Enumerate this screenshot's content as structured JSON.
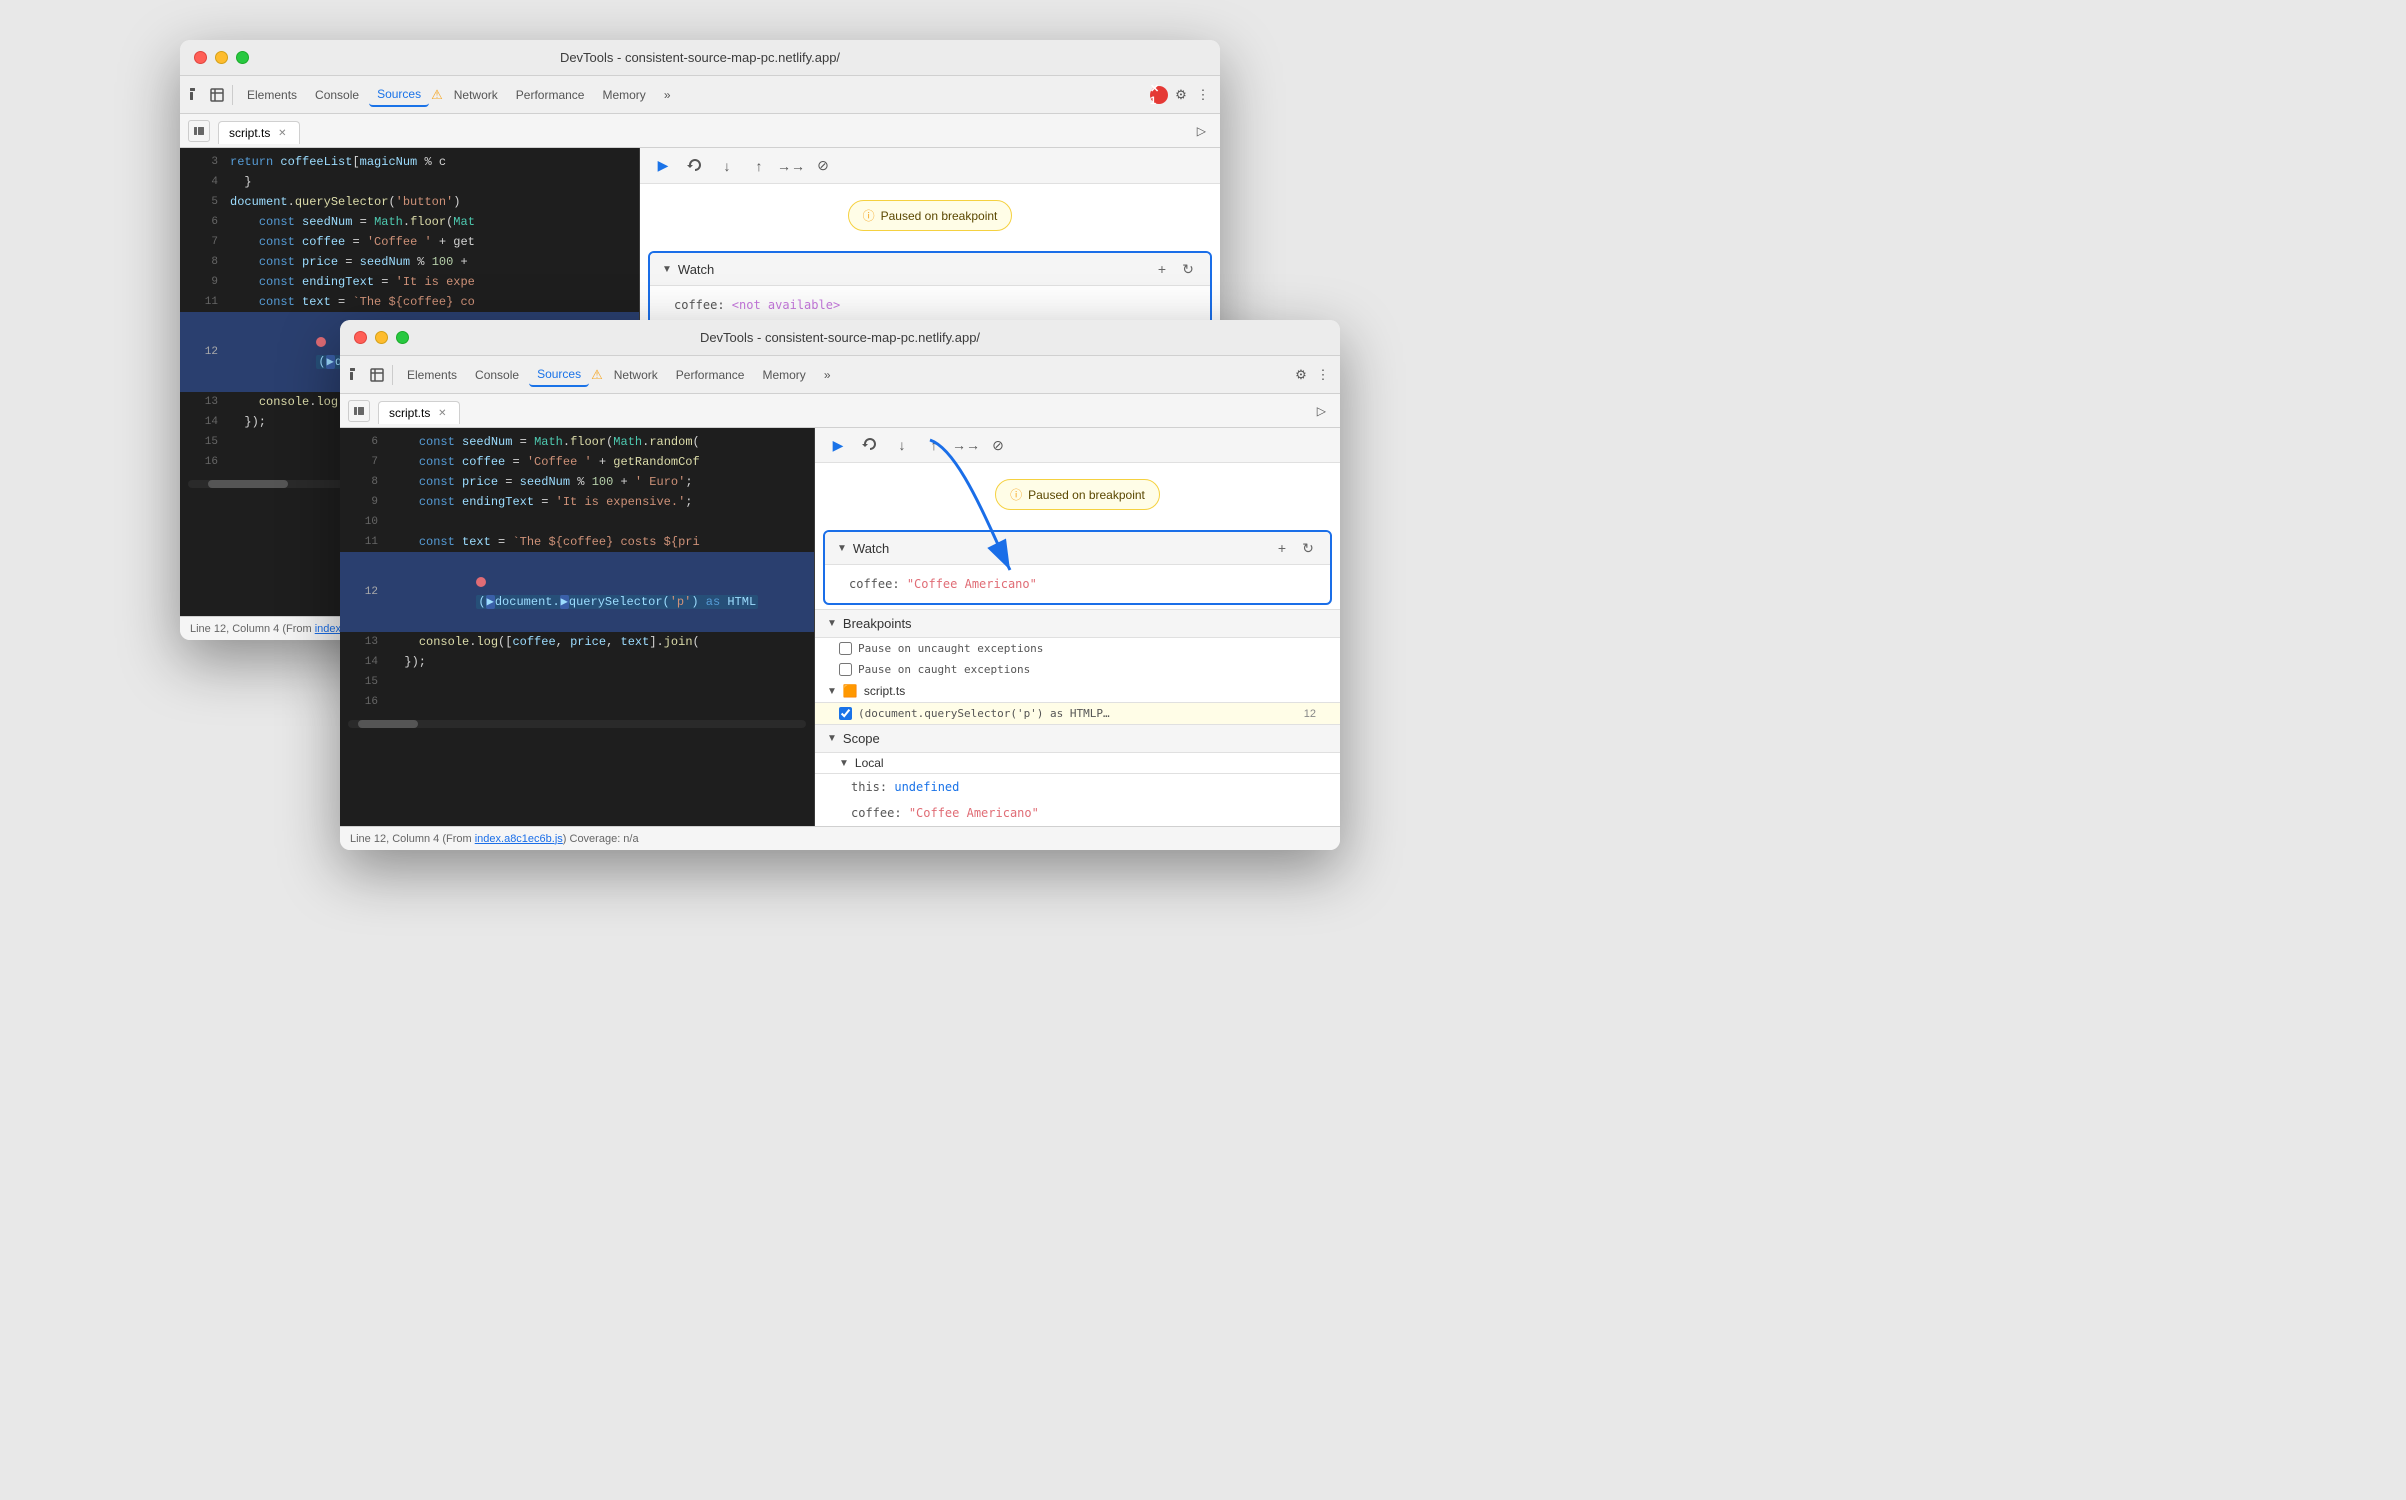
{
  "window_back": {
    "title": "DevTools - consistent-source-map-pc.netlify.app/",
    "tabs": [
      "Elements",
      "Console",
      "Sources",
      "Network",
      "Performance",
      "Memory"
    ],
    "active_tab": "Sources",
    "file_tab": "script.ts",
    "code_lines": [
      {
        "num": 3,
        "content": "    return coffeeList[magicNum % c"
      },
      {
        "num": 4,
        "content": "  }"
      },
      {
        "num": 5,
        "content": "  document.querySelector('button')"
      },
      {
        "num": 6,
        "content": "    const seedNum = Math.floor(Mat"
      },
      {
        "num": 7,
        "content": "    const coffee = 'Coffee ' + get"
      },
      {
        "num": 8,
        "content": "    const price = seedNum % 100 +"
      },
      {
        "num": 9,
        "content": "    const endingText = 'It is expe"
      },
      {
        "num": 11,
        "content": "    const text = `The ${coffee} co"
      },
      {
        "num": 12,
        "content": "    (document.querySelector",
        "highlighted": true,
        "breakpoint": true
      },
      {
        "num": 13,
        "content": "    console.log([coffee"
      },
      {
        "num": 14,
        "content": "  });"
      },
      {
        "num": 15,
        "content": ""
      },
      {
        "num": 16,
        "content": ""
      }
    ],
    "status_bar": "Line 12, Column 4 (From index.a",
    "paused_text": "Paused on breakpoint",
    "watch": {
      "title": "Watch",
      "entry": "coffee: <not available>"
    },
    "breakpoints_title": "Breakpoints",
    "breakpoints_subtitle": "Pause on uncaught exception"
  },
  "window_front": {
    "title": "DevTools - consistent-source-map-pc.netlify.app/",
    "tabs": [
      "Elements",
      "Console",
      "Sources",
      "Network",
      "Performance",
      "Memory"
    ],
    "active_tab": "Sources",
    "file_tab": "script.ts",
    "code_lines": [
      {
        "num": 6,
        "content": "    const seedNum = Math.floor(Math.random("
      },
      {
        "num": 7,
        "content": "    const coffee = 'Coffee ' + getRandomCof"
      },
      {
        "num": 8,
        "content": "    const price = seedNum % 100 + ' Euro';"
      },
      {
        "num": 9,
        "content": "    const endingText = 'It is expensive.';"
      },
      {
        "num": 10,
        "content": ""
      },
      {
        "num": 11,
        "content": "    const text = `The ${coffee} costs ${pri"
      },
      {
        "num": 12,
        "content": "    (document.querySelector('p') as HTML",
        "highlighted": true,
        "breakpoint": true
      },
      {
        "num": 13,
        "content": "    console.log([coffee, price, text].join("
      },
      {
        "num": 14,
        "content": "  });"
      },
      {
        "num": 15,
        "content": ""
      },
      {
        "num": 16,
        "content": ""
      }
    ],
    "status_bar": "Line 12, Column 4  (From index.a8c1ec6b.js) Coverage: n/a",
    "paused_text": "Paused on breakpoint",
    "watch": {
      "title": "Watch",
      "entry_key": "coffee:",
      "entry_value": "\"Coffee Americano\""
    },
    "breakpoints": {
      "title": "Breakpoints",
      "pause_uncaught": "Pause on uncaught exceptions",
      "pause_caught": "Pause on caught exceptions",
      "script_file": "script.ts",
      "bp_label": "(document.querySelector('p') as HTMLP…",
      "bp_line": "12"
    },
    "scope": {
      "title": "Scope",
      "local_title": "Local",
      "items": [
        {
          "key": "this:",
          "value": "undefined"
        },
        {
          "key": "coffee:",
          "value": "\"Coffee Americano\""
        }
      ]
    }
  },
  "arrow": {
    "from": "watch_box_back",
    "to": "watch_box_front"
  },
  "icons": {
    "cursor": "⌖",
    "inspect": "⬚",
    "more": "»",
    "settings": "⚙",
    "dots": "⋮",
    "play": "▶",
    "step_over": "↷",
    "step_into": "↓",
    "step_out": "↑",
    "continue": "→→",
    "deactivate": "⊘",
    "plus": "+",
    "refresh": "↻",
    "info": "ⓘ",
    "triangle_down": "▼",
    "triangle_right": "▶",
    "close": "✕",
    "warning": "⚠"
  }
}
